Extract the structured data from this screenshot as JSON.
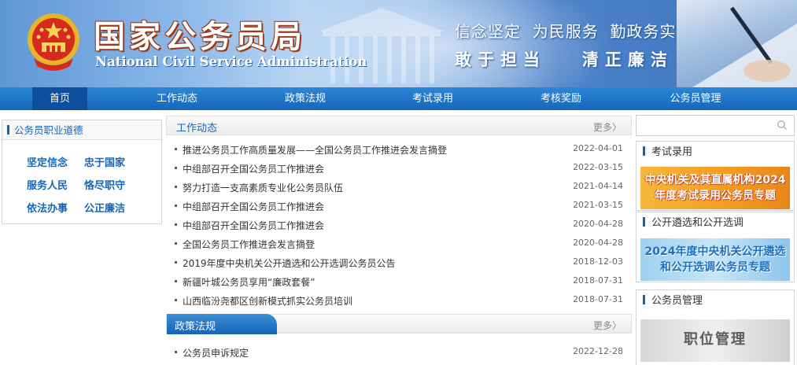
{
  "header": {
    "title": "国家公务员局",
    "subtitle": "National Civil Service Administration",
    "slogan_line1": "信念坚定  为民服务  勤政务实",
    "slogan_line2": "敢于担当   清正廉洁"
  },
  "nav": {
    "items": [
      {
        "label": "首页",
        "active": true
      },
      {
        "label": "工作动态"
      },
      {
        "label": "政策法规"
      },
      {
        "label": "考试录用"
      },
      {
        "label": "考核奖励"
      },
      {
        "label": "公务员管理"
      }
    ]
  },
  "ethics": {
    "title": "公务员职业道德",
    "items": [
      "坚定信念",
      "忠于国家",
      "服务人民",
      "恪尽职守",
      "依法办事",
      "公正廉洁"
    ]
  },
  "news": {
    "title": "工作动态",
    "more": "更多〉",
    "items": [
      {
        "title": "推进公务员工作高质量发展——全国公务员工作推进会发言摘登",
        "date": "2022-04-01"
      },
      {
        "title": "中组部召开全国公务员工作推进会",
        "date": "2022-03-15"
      },
      {
        "title": "努力打造一支高素质专业化公务员队伍",
        "date": "2021-04-14"
      },
      {
        "title": "中组部召开全国公务员工作推进会",
        "date": "2021-03-15"
      },
      {
        "title": "中组部召开全国公务员工作推进会",
        "date": "2020-04-28"
      },
      {
        "title": "全国公务员工作推进会发言摘登",
        "date": "2020-04-28"
      },
      {
        "title": "2019年度中央机关公开遴选和公开选调公务员公告",
        "date": "2018-12-03"
      },
      {
        "title": "新疆叶城公务员享用“廉政套餐”",
        "date": "2018-07-31"
      },
      {
        "title": "山西临汾尧都区创新模式抓实公务员培训",
        "date": "2018-07-31"
      }
    ]
  },
  "policy": {
    "title": "政策法规",
    "more": "更多〉",
    "items": [
      {
        "title": "公务员申诉规定",
        "date": "2022-12-28"
      }
    ]
  },
  "sidebar": {
    "search_placeholder": "",
    "exam": {
      "title": "考试录用",
      "banner_line1": "中央机关及其直属机构2024",
      "banner_line2": "年度考试录用公务员专题"
    },
    "select": {
      "title": "公开遴选和公开选调",
      "banner_line1": "2024年度中央机关公开遴选",
      "banner_line2": "和公开选调公务员专题"
    },
    "manage": {
      "title": "公务员管理",
      "banner_label": "职位管理"
    }
  },
  "colors": {
    "primary": "#1763b4",
    "nav": "#1a6fc4",
    "nav_active": "#0d4f9c"
  }
}
